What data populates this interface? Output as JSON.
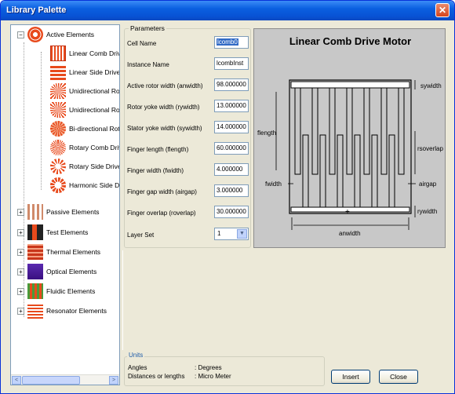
{
  "window": {
    "title": "Library Palette",
    "close_glyph": "✕"
  },
  "tree": {
    "categories": [
      {
        "label": "Active Elements",
        "expander": "−"
      },
      {
        "label": "Passive Elements",
        "expander": "+"
      },
      {
        "label": "Test Elements",
        "expander": "+"
      },
      {
        "label": "Thermal Elements",
        "expander": "+"
      },
      {
        "label": "Optical Elements",
        "expander": "+"
      },
      {
        "label": "Fluidic Elements",
        "expander": "+"
      },
      {
        "label": "Resonator Elements",
        "expander": "+"
      }
    ],
    "active_children": [
      {
        "label": "Linear Comb Drive"
      },
      {
        "label": "Linear Side Drive I"
      },
      {
        "label": "Unidirectional Rot"
      },
      {
        "label": "Unidirectional Rot"
      },
      {
        "label": "Bi-directional Rota"
      },
      {
        "label": "Rotary Comb Drive"
      },
      {
        "label": "Rotary Side Drive"
      },
      {
        "label": "Harmonic Side Dri"
      }
    ]
  },
  "parameters": {
    "legend": "Parameters",
    "fields": [
      {
        "label": "Cell Name",
        "value": "lcomb0"
      },
      {
        "label": "Instance Name",
        "value": "lcombInst"
      },
      {
        "label": "Active rotor width (anwidth)",
        "value": "98.000000"
      },
      {
        "label": "Rotor yoke width (rywidth)",
        "value": "13.000000"
      },
      {
        "label": "Stator yoke width (sywidth)",
        "value": "14.000000"
      },
      {
        "label": "Finger length (flength)",
        "value": "60.000000"
      },
      {
        "label": "Finger width (fwidth)",
        "value": "4.000000"
      },
      {
        "label": "Finger gap width (airgap)",
        "value": "3.000000"
      },
      {
        "label": "Finger overlap (roverlap)",
        "value": "30.000000"
      }
    ],
    "layer_set": {
      "label": "Layer Set",
      "value": "1"
    }
  },
  "diagram": {
    "title": "Linear Comb Drive Motor",
    "labels": {
      "sywidth": "sywidth",
      "flength": "flength",
      "rsoverlap": "rsoverlap",
      "fwidth": "fwidth",
      "airgap": "airgap",
      "rywidth": "rywidth",
      "anwidth": "anwidth",
      "center": "+"
    }
  },
  "units": {
    "legend": "Units",
    "angles_label": "Angles",
    "angles_value": ": Degrees",
    "distances_label": "Distances or lengths",
    "distances_value": ": Micro Meter"
  },
  "buttons": {
    "insert": "Insert",
    "close": "Close"
  },
  "scroll": {
    "left": "<",
    "right": ">"
  }
}
